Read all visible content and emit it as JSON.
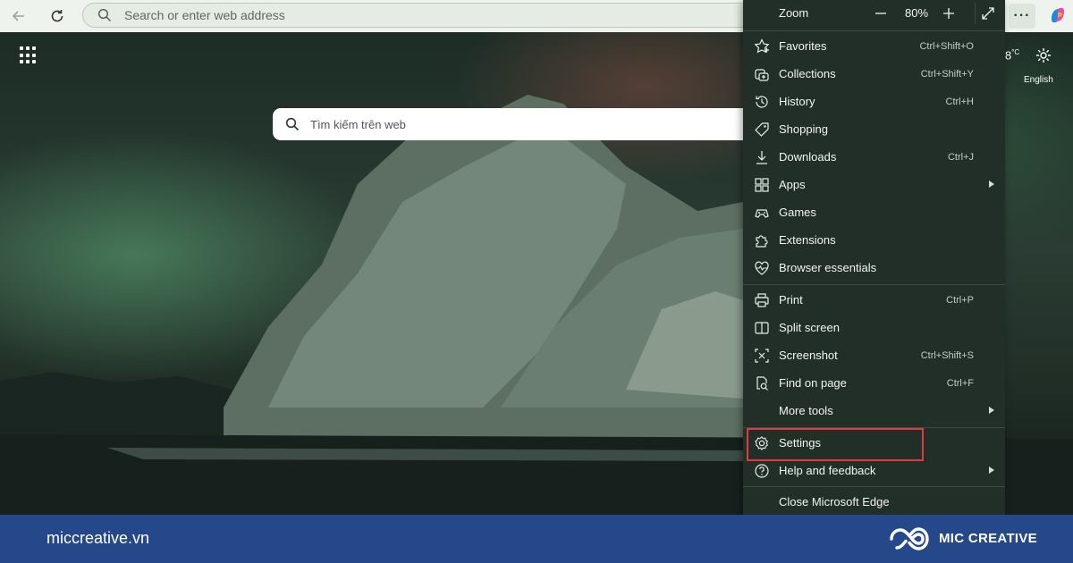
{
  "toolbar": {
    "address_placeholder": "Search or enter web address",
    "more_label": "···"
  },
  "newtab": {
    "search_placeholder": "Tìm kiếm trên web",
    "weather_temp": "8",
    "weather_unit": "°C",
    "language": "English"
  },
  "menu": {
    "zoom": {
      "label": "Zoom",
      "minus": "—",
      "value": "80%",
      "plus": "+"
    },
    "items": [
      {
        "label": "Favorites",
        "shortcut": "Ctrl+Shift+O",
        "icon": "star-icon"
      },
      {
        "label": "Collections",
        "shortcut": "Ctrl+Shift+Y",
        "icon": "collections-icon"
      },
      {
        "label": "History",
        "shortcut": "Ctrl+H",
        "icon": "history-icon"
      },
      {
        "label": "Shopping",
        "shortcut": "",
        "icon": "tag-icon"
      },
      {
        "label": "Downloads",
        "shortcut": "Ctrl+J",
        "icon": "download-icon"
      },
      {
        "label": "Apps",
        "shortcut": "",
        "icon": "apps-icon",
        "submenu": true
      },
      {
        "label": "Games",
        "shortcut": "",
        "icon": "gamepad-icon"
      },
      {
        "label": "Extensions",
        "shortcut": "",
        "icon": "puzzle-icon"
      },
      {
        "label": "Browser essentials",
        "shortcut": "",
        "icon": "heart-pulse-icon"
      },
      {
        "label": "Print",
        "shortcut": "Ctrl+P",
        "icon": "printer-icon"
      },
      {
        "label": "Split screen",
        "shortcut": "",
        "icon": "split-screen-icon"
      },
      {
        "label": "Screenshot",
        "shortcut": "Ctrl+Shift+S",
        "icon": "screenshot-icon"
      },
      {
        "label": "Find on page",
        "shortcut": "Ctrl+F",
        "icon": "find-icon"
      },
      {
        "label": "More tools",
        "shortcut": "",
        "icon": "",
        "submenu": true
      },
      {
        "label": "Settings",
        "shortcut": "",
        "icon": "gear-icon"
      },
      {
        "label": "Help and feedback",
        "shortcut": "",
        "icon": "help-icon",
        "submenu": true
      },
      {
        "label": "Close Microsoft Edge",
        "shortcut": "",
        "icon": ""
      }
    ]
  },
  "footer": {
    "site_url": "miccreative.vn",
    "brand_name": "MIC CREATIVE"
  },
  "colors": {
    "highlight": "#e0393e",
    "banner": "#25488a",
    "menu_bg": "#222f29"
  }
}
